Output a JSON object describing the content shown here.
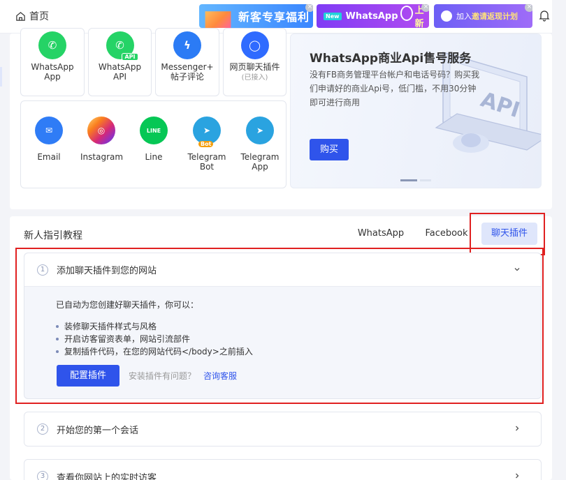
{
  "topbar": {
    "home_label": "首页",
    "banner1": "新客专享福利",
    "banner2_tag": "New",
    "banner2_a": "WhatsApp",
    "banner2_b": "上新",
    "banner3_a": "加入",
    "banner3_b": "邀请返现计划",
    "close_glyph": "×"
  },
  "channels": {
    "row1": [
      {
        "label": "WhatsApp",
        "sub": "App",
        "color": "#25d366"
      },
      {
        "label": "WhatsApp",
        "sub": "API",
        "color": "#25d366",
        "badge": "API"
      },
      {
        "label": "Messenger+",
        "sub": "帖子评论",
        "color": "#2b7bf5"
      },
      {
        "label": "网页聊天插件",
        "sub": "(已接入)",
        "color": "#2f6bff"
      }
    ],
    "row2": [
      {
        "label": "Email",
        "color": "#2f7cf6"
      },
      {
        "label": "Instagram",
        "color": "#e1306c"
      },
      {
        "label": "Line",
        "color": "#06c755",
        "badge": "LINE"
      },
      {
        "label": "Telegram Bot",
        "color": "#2aa3e0",
        "badge": "Bot"
      },
      {
        "label": "Telegram App",
        "color": "#2aa3e0"
      }
    ]
  },
  "api_banner": {
    "title": "WhatsApp商业Api售号服务",
    "desc": "没有FB商务管理平台帐户和电话号码？购买我们申请好的商业Api号，低门槛，不用30分钟即可进行商用",
    "button": "购买",
    "art_text": "API"
  },
  "guide": {
    "title": "新人指引教程",
    "tabs": [
      "WhatsApp",
      "Facebook",
      "聊天插件"
    ],
    "active_tab": 2,
    "steps": [
      {
        "num": "1",
        "title": "添加聊天插件到您的网站"
      },
      {
        "num": "2",
        "title": "开始您的第一个会话"
      },
      {
        "num": "3",
        "title": "查看你网站上的实时访客"
      }
    ],
    "intro": "已自动为您创建好聊天插件，你可以：",
    "bullets": [
      "装修聊天插件样式与风格",
      "开启访客留资表单，网站引流部件",
      "复制插件代码，在您的网站代码</body>之前插入"
    ],
    "config_button": "配置插件",
    "help_text": "安装插件有问题？",
    "service_link": "咨询客服"
  }
}
